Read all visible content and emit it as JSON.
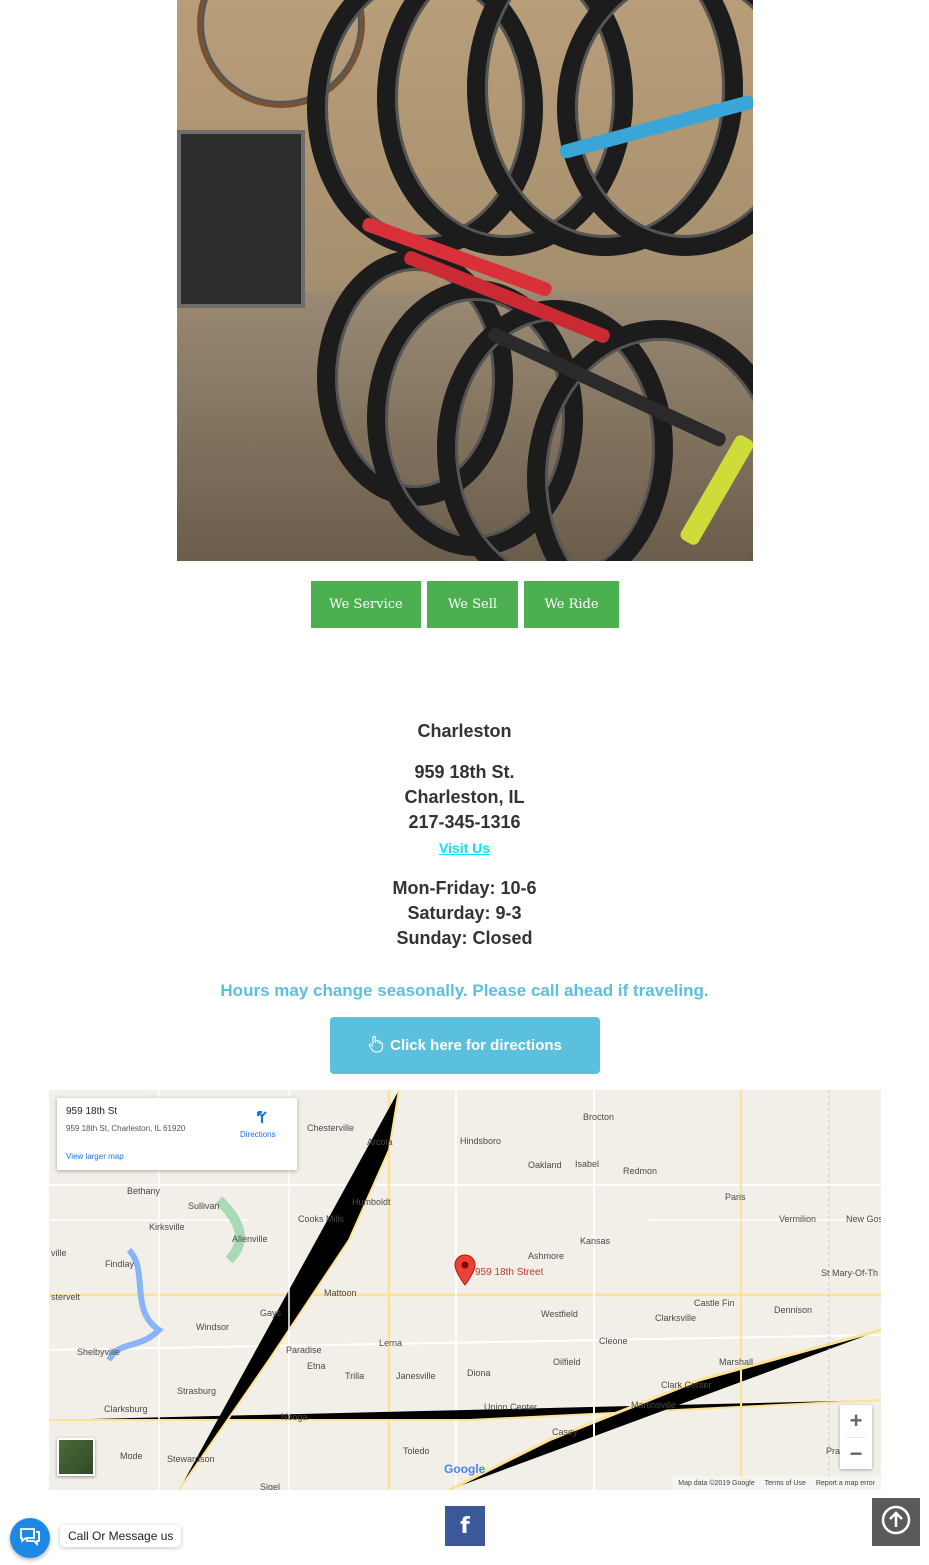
{
  "tabs": [
    {
      "label": "We Service"
    },
    {
      "label": "We Sell"
    },
    {
      "label": "We Ride"
    }
  ],
  "location": {
    "name": "Charleston",
    "street": "959 18th St.",
    "city": "Charleston, IL",
    "phone": "217-345-1316",
    "visit_link": "Visit Us"
  },
  "hours": {
    "weekdays": "Mon-Friday: 10-6",
    "saturday": "Saturday: 9-3",
    "sunday": "Sunday: Closed"
  },
  "notice": "Hours may change seasonally. Please call ahead if traveling.",
  "directions_button": "Click here for directions",
  "map": {
    "card": {
      "title": "959 18th St",
      "address": "959 18th St, Charleston, IL 61920",
      "directions_label": "Directions",
      "larger_map_label": "View larger map"
    },
    "pin_label": "959 18th Street",
    "zoom_in": "+",
    "zoom_out": "−",
    "google_logo": "Google",
    "footer": {
      "data": "Map data ©2019 Google",
      "terms": "Terms of Use",
      "report": "Report a map error"
    },
    "towns": {
      "chesterville": "Chesterville",
      "arcola": "Arcola",
      "hindsboro": "Hindsboro",
      "brocton": "Brocton",
      "oakland": "Oakland",
      "isabel": "Isabel",
      "redmon": "Redmon",
      "paris": "Paris",
      "vermilion": "Vermilion",
      "new_goshen": "New Gos",
      "humboldt": "Humboldt",
      "sullivan": "Sullivan",
      "cooks_mills": "Cooks Mills",
      "kirksville": "Kirksville",
      "allenville": "Allenville",
      "kansas": "Kansas",
      "ashmore": "Ashmore",
      "findlay": "Findlay",
      "st_mary": "St Mary-Of-Th",
      "mattoon": "Mattoon",
      "westfield": "Westfield",
      "castle_fin": "Castle Fin",
      "dennison": "Dennison",
      "gays": "Gays",
      "windsor": "Windsor",
      "clarksville": "Clarksville",
      "lerna": "Lerna",
      "cleone": "Cleone",
      "shelbyville": "Shelbyville",
      "paradise": "Paradise",
      "etna": "Etna",
      "oilfield": "Oilfield",
      "marshall": "Marshall",
      "trilla": "Trilla",
      "janesville": "Janesville",
      "diona": "Diona",
      "strasburg": "Strasburg",
      "clark_center": "Clark Center",
      "clarksburg": "Clarksburg",
      "union_center": "Union Center",
      "martinsville": "Martinsville",
      "neoga": "Neoga",
      "casey": "Casey",
      "mode": "Mode",
      "stewardson": "Stewardson",
      "toledo": "Toledo",
      "sigel": "Sigel",
      "bethany": "Bethany",
      "ville": "ville",
      "stervelt": "stervelt",
      "prairie": "Pra"
    }
  },
  "footer": {
    "facebook": "f",
    "chat_label": "Call Or Message us"
  },
  "colors": {
    "tab_green": "#4caf50",
    "accent_blue": "#5bc0de",
    "link_cyan": "#00e5ff",
    "facebook_blue": "#3b5998"
  }
}
